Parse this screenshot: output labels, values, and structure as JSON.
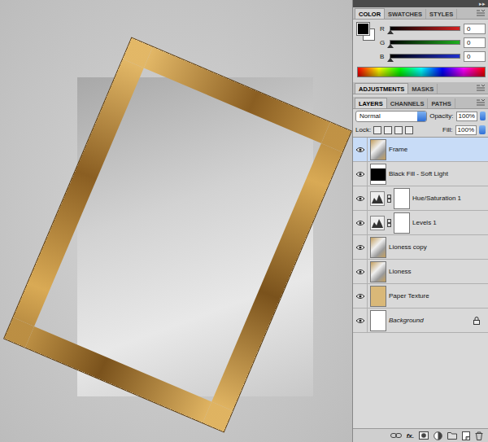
{
  "top_strip": {
    "glyph": "▸▸"
  },
  "color_panel": {
    "tabs": [
      {
        "label": "COLOR",
        "selected": true
      },
      {
        "label": "SWATCHES",
        "selected": false
      },
      {
        "label": "STYLES",
        "selected": false
      }
    ],
    "channels": [
      {
        "name": "R",
        "value": "0",
        "level": 0,
        "color": "#d42020"
      },
      {
        "name": "G",
        "value": "0",
        "level": 0,
        "color": "#20b020"
      },
      {
        "name": "B",
        "value": "0",
        "level": 0,
        "color": "#2030d0"
      }
    ]
  },
  "adjustments_panel": {
    "tabs": [
      {
        "label": "ADJUSTMENTS",
        "selected": true
      },
      {
        "label": "MASKS",
        "selected": false
      }
    ]
  },
  "layers_panel": {
    "tabs": [
      {
        "label": "LAYERS",
        "selected": true
      },
      {
        "label": "CHANNELS",
        "selected": false
      },
      {
        "label": "PATHS",
        "selected": false
      }
    ],
    "blend_mode": "Normal",
    "opacity_label": "Opacity:",
    "opacity": "100%",
    "lock_label": "Lock:",
    "fill_label": "Fill:",
    "fill": "100%",
    "layers": [
      {
        "name": "Frame",
        "kind": "pixel",
        "visible": true,
        "selected": true,
        "locked": false
      },
      {
        "name": "Black Fill - Soft Light",
        "kind": "fill",
        "visible": true,
        "selected": false,
        "locked": false
      },
      {
        "name": "Hue/Saturation 1",
        "kind": "adjustment",
        "visible": true,
        "selected": false,
        "locked": false
      },
      {
        "name": "Levels 1",
        "kind": "adjustment",
        "visible": true,
        "selected": false,
        "locked": false
      },
      {
        "name": "Lioness copy",
        "kind": "pixel",
        "visible": true,
        "selected": false,
        "locked": false
      },
      {
        "name": "Lioness",
        "kind": "pixel",
        "visible": true,
        "selected": false,
        "locked": false
      },
      {
        "name": "Paper Texture",
        "kind": "texture",
        "visible": true,
        "selected": false,
        "locked": false
      },
      {
        "name": "Background",
        "kind": "background",
        "visible": true,
        "selected": false,
        "locked": true
      }
    ],
    "footer": [
      {
        "kind": "link",
        "label": ""
      },
      {
        "kind": "fx",
        "label": "fx."
      },
      {
        "kind": "mask",
        "label": ""
      },
      {
        "kind": "adjust",
        "label": ""
      },
      {
        "kind": "folder",
        "label": ""
      },
      {
        "kind": "new",
        "label": ""
      },
      {
        "kind": "trash",
        "label": ""
      }
    ]
  }
}
